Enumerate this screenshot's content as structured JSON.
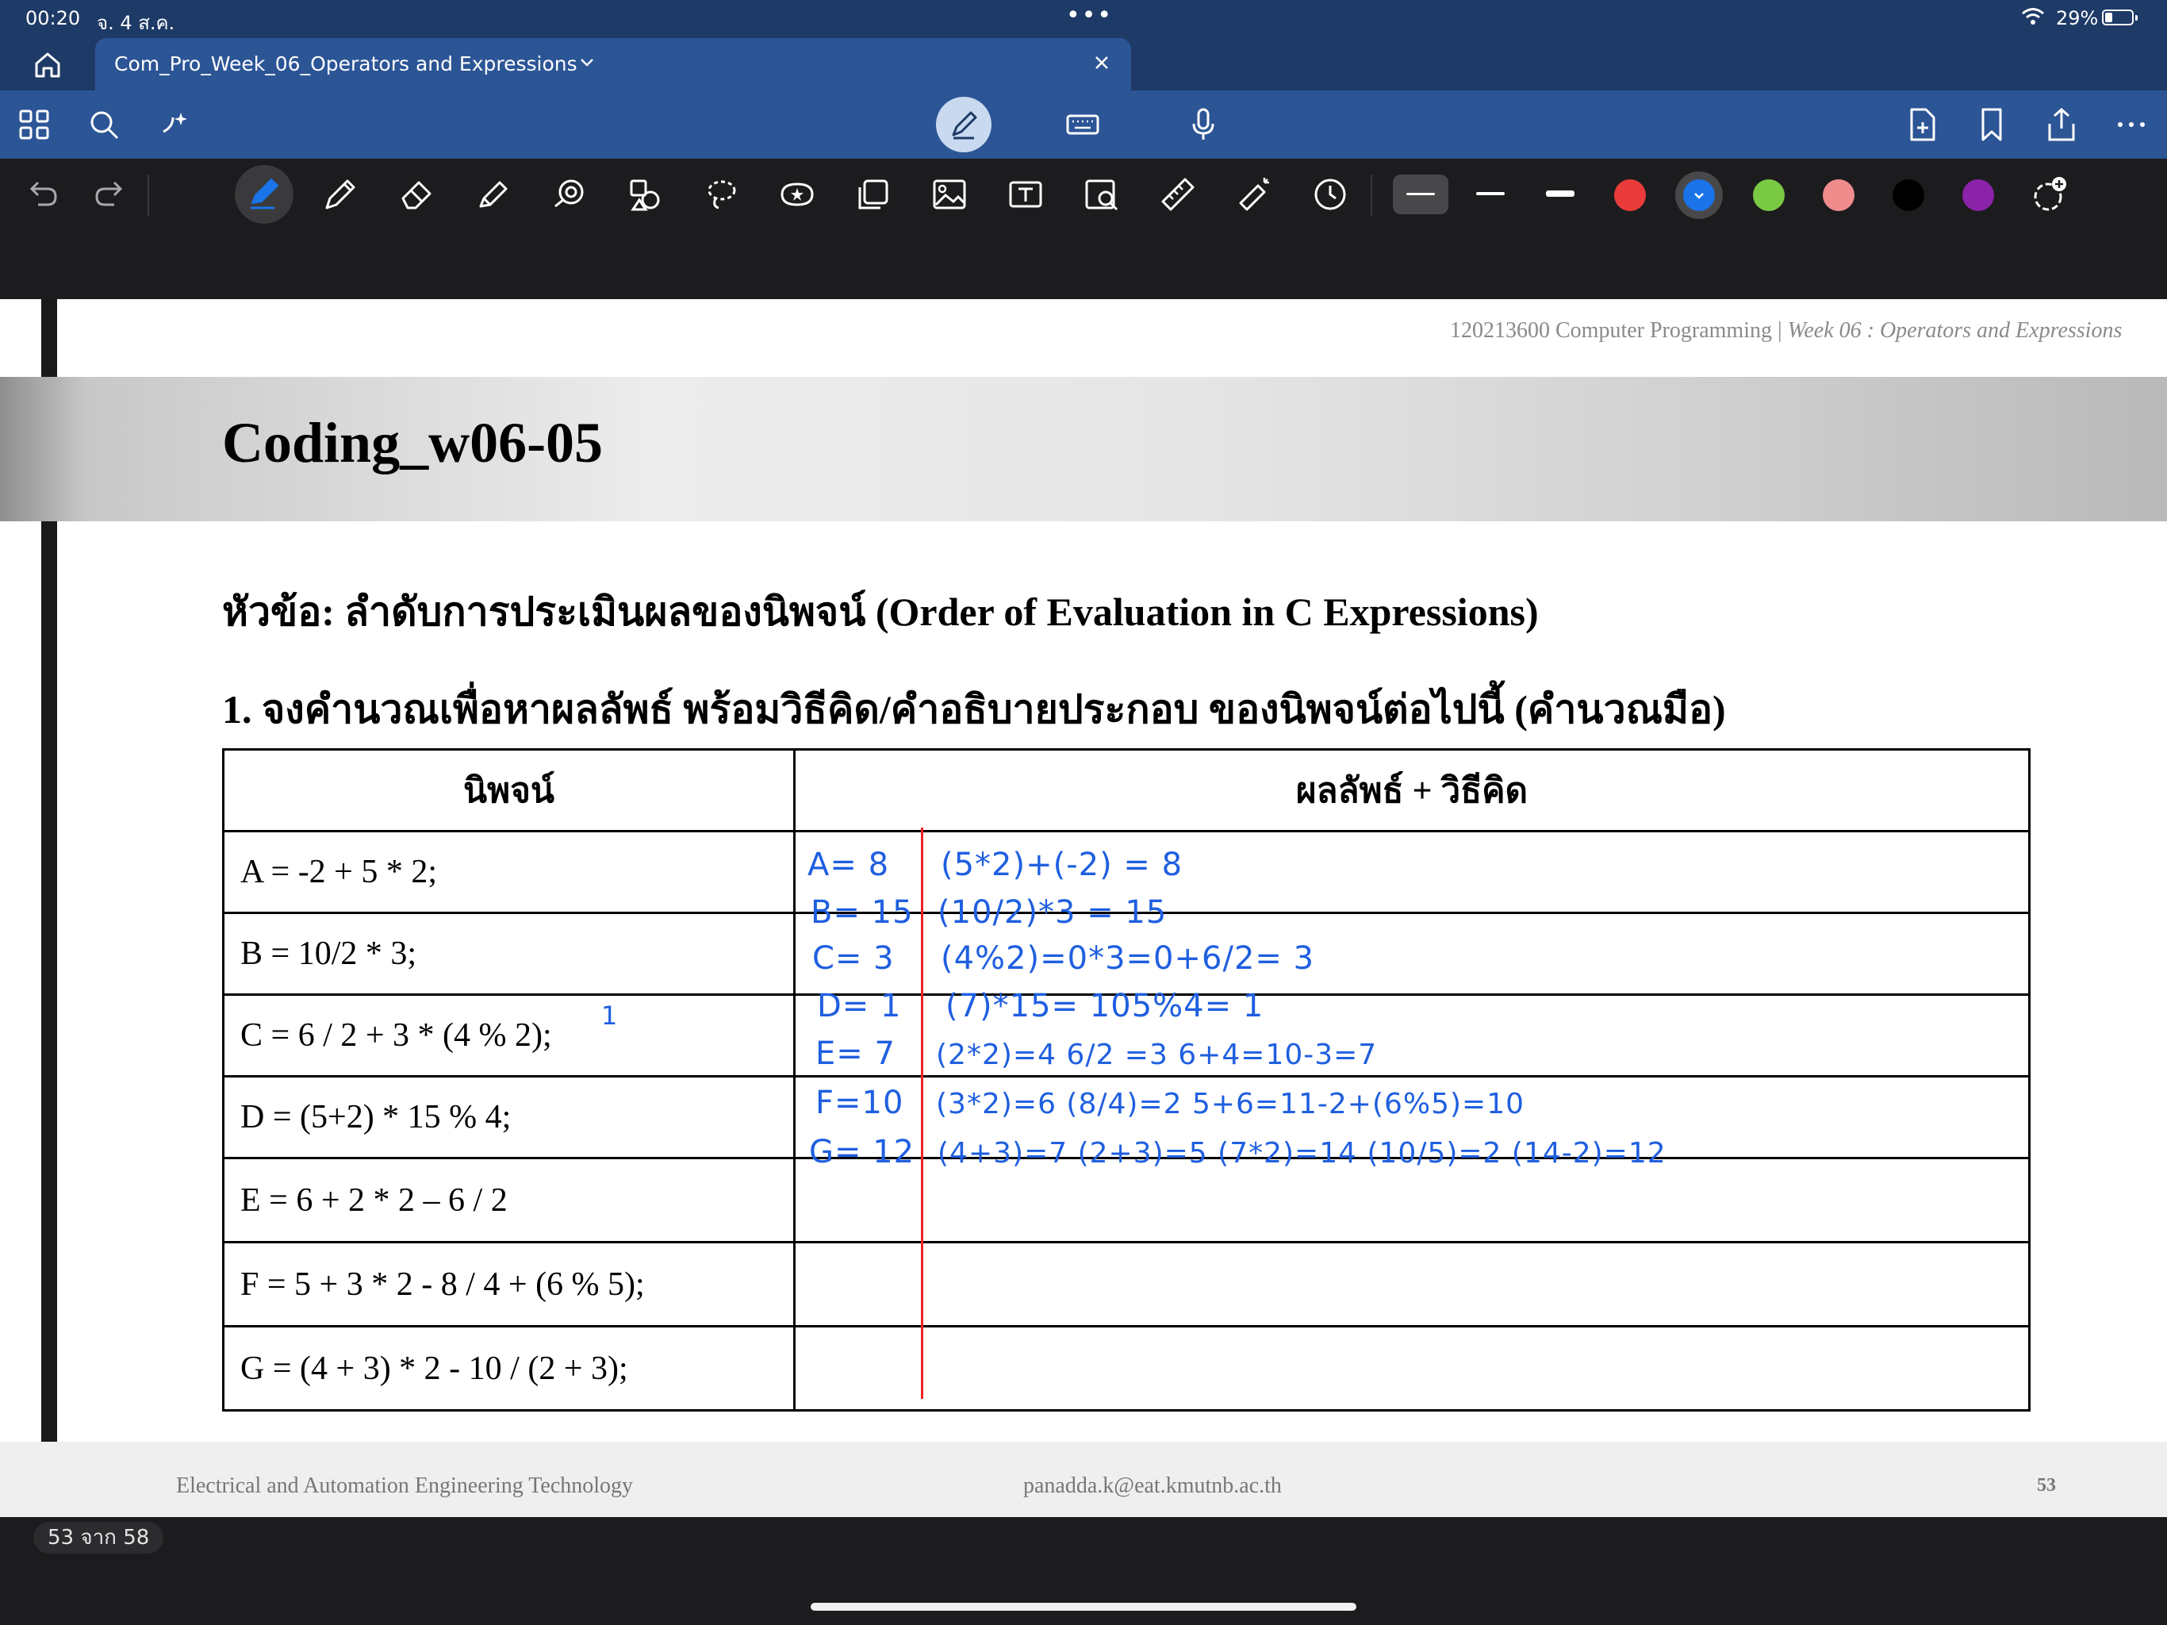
{
  "status_bar": {
    "time": "00:20",
    "date": "จ. 4 ส.ค.",
    "dots": "•••",
    "battery_percent": "29%",
    "battery_level": 0.29
  },
  "tab_bar": {
    "tab_title": "Com_Pro_Week_06_Operators and Expressions"
  },
  "toolbar": {
    "left_icons": [
      "grid-icon",
      "search-icon",
      "sparkle-icon"
    ],
    "center_icons": [
      "pen-mode-icon",
      "keyboard-icon",
      "microphone-icon"
    ],
    "right_icons": [
      "add-page-icon",
      "bookmark-icon",
      "share-icon",
      "more-icon"
    ]
  },
  "tools": {
    "items": [
      "undo-icon",
      "redo-icon",
      "pen-icon",
      "pencil-icon",
      "eraser-icon",
      "highlighter-icon",
      "shape-icon",
      "element-icon",
      "lasso-icon",
      "sticker-icon",
      "sticky-note-icon",
      "image-icon",
      "text-icon",
      "scan-icon",
      "ruler-icon",
      "laser-pointer-icon",
      "recent-icon"
    ],
    "colors": [
      "#ea3b3b",
      "#1a73e8",
      "#7ac943",
      "#f08c8c",
      "#000000",
      "#8a23a8"
    ],
    "selected_color": "#1a73e8"
  },
  "slide": {
    "header": "120213600 Computer Programming | ",
    "header_italic": "Week 06 : Operators and Expressions",
    "title": "Coding_w06-05",
    "topic": "หัวข้อ: ลำดับการประเมินผลของนิพจน์ (Order of Evaluation in C Expressions)",
    "question": "1. จงคำนวณเพื่อหาผลลัพธ์ พร้อมวิธีคิด/คำอธิบายประกอบ ของนิพจน์ต่อไปนี้ (คำนวณมือ)",
    "table": {
      "headers": [
        "นิพจน์",
        "ผลลัพธ์ + วิธีคิด"
      ],
      "rows": [
        {
          "expr": "A = -2 + 5 * 2;",
          "result": "A= 8",
          "work": "(5*2)+(-2) = 8"
        },
        {
          "expr": "B = 10/2 * 3;",
          "result": "B= 15",
          "work": "(10/2)*3 = 15"
        },
        {
          "expr": "C = 6 / 2 + 3 * (4 % 2);",
          "result": "C= 3",
          "work": "(4%2)=0*3=0+6/2= 3"
        },
        {
          "expr": "D = (5+2) * 15 % 4;",
          "result": "D= 1",
          "work": "(7)*15= 105%4= 1"
        },
        {
          "expr": "E = 6 + 2 * 2 – 6 / 2",
          "result": "E= 7",
          "work": "(2*2)=4  6/2 =3   6+4=10-3=7"
        },
        {
          "expr": "F = 5 + 3 * 2 - 8 / 4 + (6 % 5);",
          "result": "F=10",
          "work": "(3*2)=6 (8/4)=2  5+6=11-2+(6%5)=10"
        },
        {
          "expr": "G = (4 + 3) * 2 - 10 / (2 + 3);",
          "result": "G= 12",
          "work": "(4+3)=7 (2+3)=5 (7*2)=14 (10/5)=2  (14-2)=12"
        }
      ],
      "annotation": "1"
    },
    "footer_dept": "Electrical and Automation Engineering Technology",
    "footer_email": "panadda.k@eat.kmutnb.ac.th",
    "footer_page": "53"
  },
  "page_counter": "53 จาก 58"
}
